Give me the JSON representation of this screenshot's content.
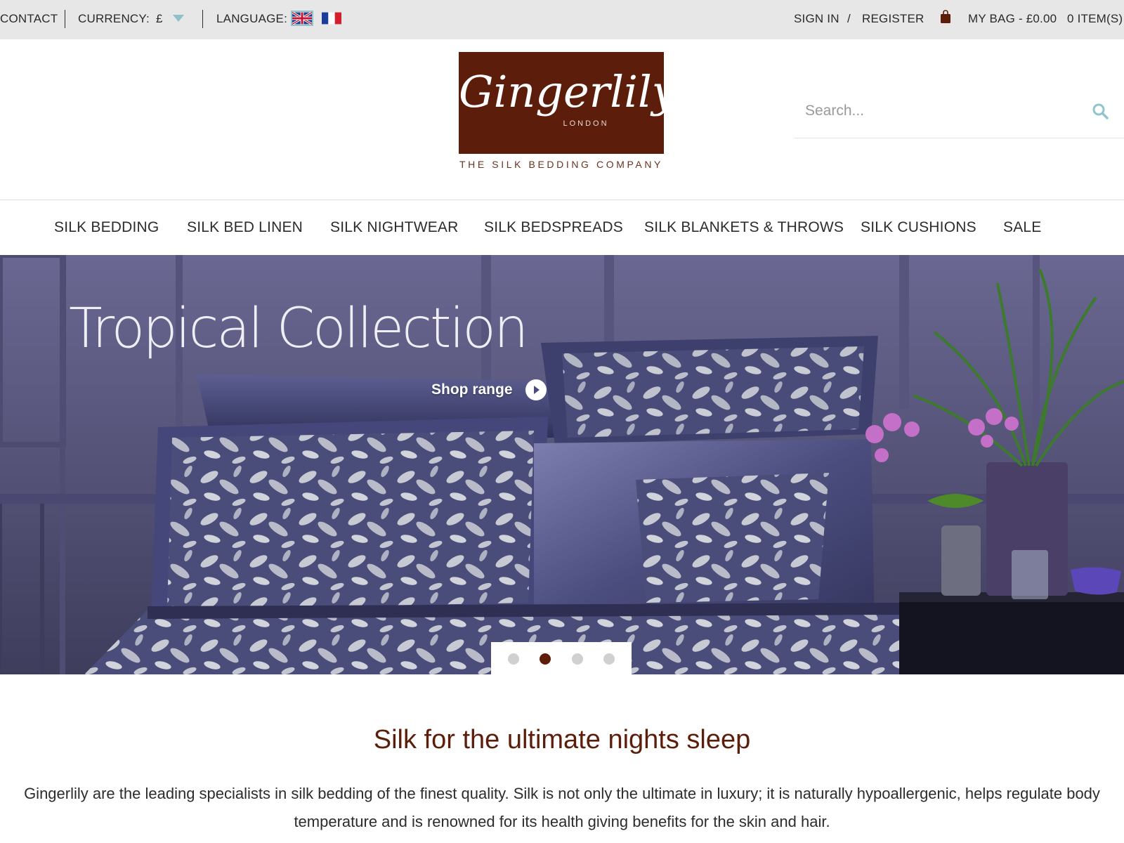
{
  "topbar": {
    "contact": "CONTACT",
    "currency_label": "CURRENCY:",
    "currency_value": "£",
    "language_label": "LANGUAGE:",
    "languages": [
      "English",
      "Français"
    ],
    "sign_in": "SIGN IN",
    "slash": "/",
    "register": "REGISTER",
    "bag": "MY BAG - £0.00",
    "items": "0 ITEM(S)"
  },
  "header": {
    "logo_script": "Gingerlily",
    "logo_sub": "LONDON",
    "tagline": "THE SILK BEDDING COMPANY",
    "logo_color": "#5c1e0b"
  },
  "search": {
    "placeholder": "Search...",
    "icon": "search-icon",
    "icon_color": "#8fc5cc"
  },
  "nav": {
    "items": [
      "SILK BEDDING",
      "SILK BED LINEN",
      "SILK NIGHTWEAR",
      "SILK BEDSPREADS",
      "SILK BLANKETS & THROWS",
      "SILK CUSHIONS",
      "SALE"
    ]
  },
  "hero": {
    "title": "Tropical Collection",
    "cta": "Shop range",
    "slide_count": 4,
    "active_slide": 2
  },
  "intro": {
    "heading": "Silk for the ultimate nights sleep",
    "text": "Gingerlily are the leading specialists in silk bedding of the finest quality. Silk is not only the ultimate in luxury; it is naturally hypoallergenic, helps regulate body temperature and is renowned for its health giving benefits for the skin and hair."
  },
  "colors": {
    "accent": "#5c1e0b",
    "topbar_bg": "#e7e7e7",
    "hero_wall": "#5a587e"
  }
}
